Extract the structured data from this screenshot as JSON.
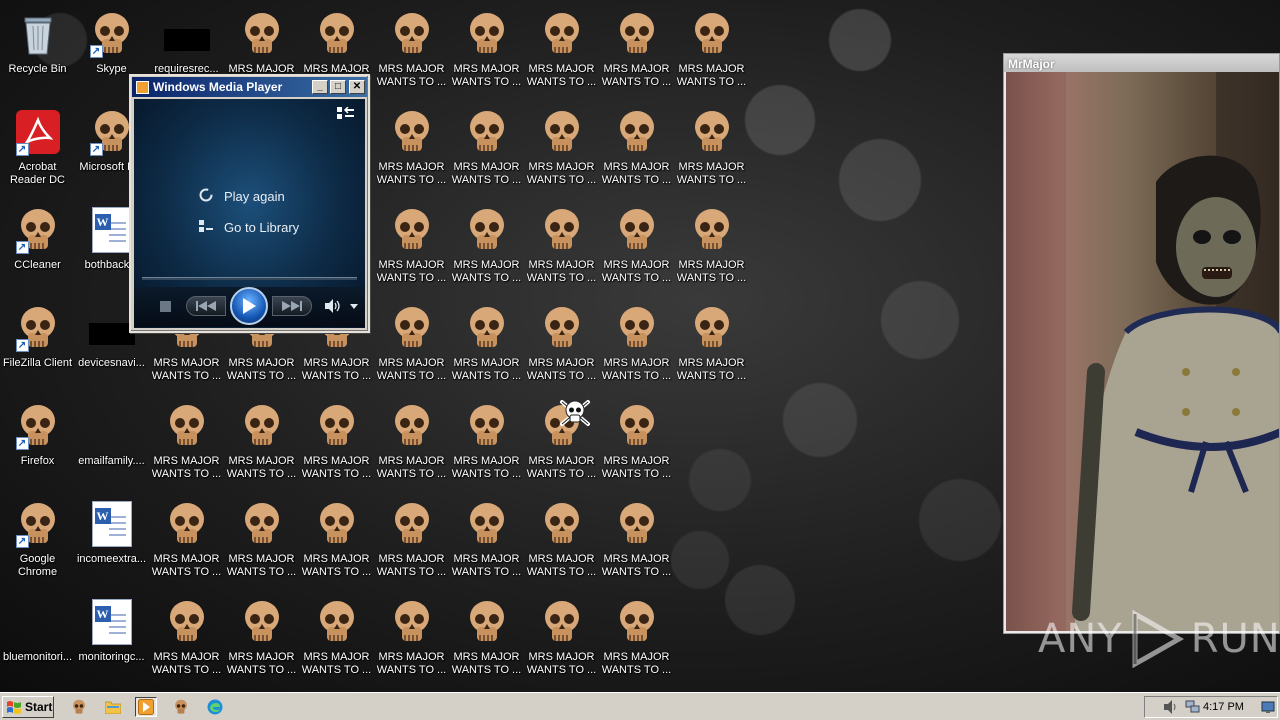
{
  "desktop": {
    "sidebar_icons": [
      {
        "label": "Recycle Bin",
        "kind": "recycle-bin"
      },
      {
        "label": "Skype",
        "kind": "skull"
      },
      {
        "label": "requiresrec...",
        "kind": "black-thumb"
      },
      {
        "label": "Acrobat\nReader DC",
        "kind": "acrobat"
      },
      {
        "label": "Microsoft E...",
        "kind": "skull"
      },
      {
        "label": "CCleaner",
        "kind": "skull"
      },
      {
        "label": "bothback...",
        "kind": "word-doc"
      },
      {
        "label": "FileZilla Client",
        "kind": "skull"
      },
      {
        "label": "devicesnavi...",
        "kind": "black-thumb"
      },
      {
        "label": "Firefox",
        "kind": "skull"
      },
      {
        "label": "emailfamily....",
        "kind": "none"
      },
      {
        "label": "Google\nChrome",
        "kind": "skull"
      },
      {
        "label": "incomeextra...",
        "kind": "word-doc"
      },
      {
        "label": "bluemonitori...",
        "kind": "none"
      },
      {
        "label": "monitoringc...",
        "kind": "word-doc"
      }
    ],
    "ransom_file_label": "MRS MAJOR\nWANTS TO ...",
    "wallpaper_theme": "skulls"
  },
  "media_player": {
    "title": "Windows Media Player",
    "minimize_glyph": "_",
    "maximize_glyph": "□",
    "close_glyph": "✕",
    "play_again_label": "Play again",
    "go_to_library_label": "Go to Library"
  },
  "mrmajor_window": {
    "title": "MrMajor"
  },
  "watermark": {
    "left": "ANY",
    "right": "RUN"
  },
  "taskbar": {
    "start_label": "Start",
    "clock": "4:17 PM"
  },
  "colors": {
    "titlebar_active": "#0a246a",
    "taskbar": "#d4d0c8",
    "skull": "#d9a878"
  }
}
